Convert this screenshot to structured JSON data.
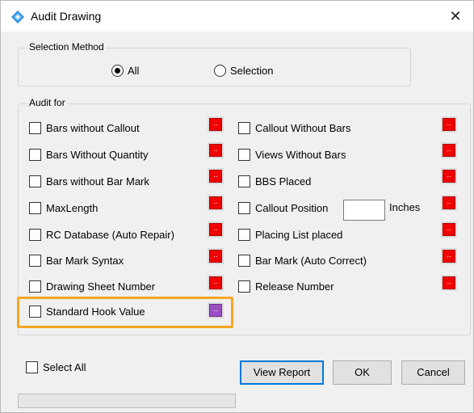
{
  "window": {
    "title": "Audit Drawing",
    "close_glyph": "✕"
  },
  "selection_method": {
    "label": "Selection Method",
    "options": [
      {
        "label": "All",
        "selected": true
      },
      {
        "label": "Selection",
        "selected": false
      }
    ]
  },
  "audit_for": {
    "label": "Audit for",
    "left": [
      {
        "label": "Bars without Callout",
        "checked": false,
        "color": "#f00000"
      },
      {
        "label": "Bars Without Quantity",
        "checked": false,
        "color": "#f00000"
      },
      {
        "label": "Bars without Bar Mark",
        "checked": false,
        "color": "#f00000"
      },
      {
        "label": "MaxLength",
        "checked": false,
        "color": "#f00000"
      },
      {
        "label": "RC Database (Auto Repair)",
        "checked": false,
        "color": "#f00000"
      },
      {
        "label": "Bar Mark Syntax",
        "checked": false,
        "color": "#f00000"
      },
      {
        "label": "Drawing Sheet Number",
        "checked": false,
        "color": "#f00000"
      },
      {
        "label": "Standard Hook Value",
        "checked": false,
        "color": "#9c4fc4",
        "highlighted": true
      }
    ],
    "right": [
      {
        "label": "Callout Without Bars",
        "checked": false,
        "color": "#f00000"
      },
      {
        "label": "Views Without Bars",
        "checked": false,
        "color": "#f00000"
      },
      {
        "label": "BBS Placed",
        "checked": false,
        "color": "#f00000"
      },
      {
        "label": "Callout Position",
        "checked": false,
        "color": "#f00000",
        "input_value": "",
        "unit": "Inches"
      },
      {
        "label": "Placing List placed",
        "checked": false,
        "color": "#f00000"
      },
      {
        "label": "Bar Mark (Auto Correct)",
        "checked": false,
        "color": "#f00000"
      },
      {
        "label": "Release Number",
        "checked": false,
        "color": "#f00000"
      }
    ],
    "swatch_glyph": ".."
  },
  "footer": {
    "select_all": {
      "label": "Select All",
      "checked": false
    },
    "buttons": {
      "view_report": "View Report",
      "ok": "OK",
      "cancel": "Cancel"
    },
    "progress": 0
  },
  "colors": {
    "accent": "#0078d7",
    "highlight": "#f5a623",
    "error": "#f00000",
    "purple": "#9c4fc4"
  }
}
